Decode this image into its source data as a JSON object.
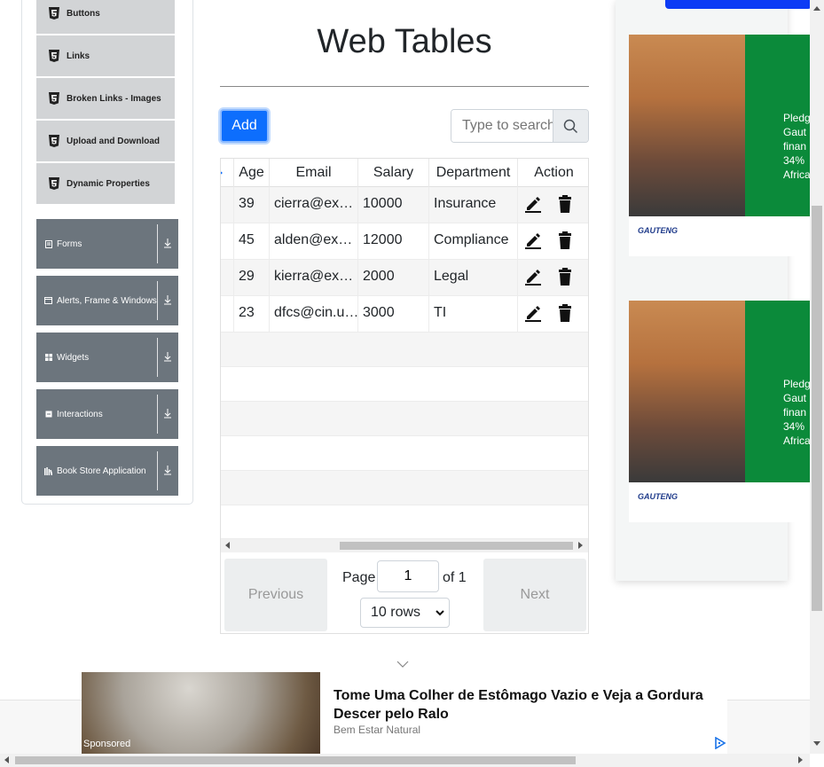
{
  "sidebar": {
    "sub_items": [
      "Buttons",
      "Links",
      "Broken Links - Images",
      "Upload and Download",
      "Dynamic Properties"
    ],
    "groups": [
      "Forms",
      "Alerts, Frame & Windows",
      "Widgets",
      "Interactions",
      "Book Store Application"
    ]
  },
  "main": {
    "title": "Web Tables",
    "add_label": "Add",
    "search": {
      "placeholder": "Type to search"
    }
  },
  "table": {
    "columns": [
      "Age",
      "Email",
      "Salary",
      "Department",
      "Action"
    ],
    "rows": [
      {
        "age": "39",
        "email": "cierra@ex…",
        "salary": "10000",
        "department": "Insurance"
      },
      {
        "age": "45",
        "email": "alden@ex…",
        "salary": "12000",
        "department": "Compliance"
      },
      {
        "age": "29",
        "email": "kierra@ex…",
        "salary": "2000",
        "department": "Legal"
      },
      {
        "age": "23",
        "email": "dfcs@cin.u…",
        "salary": "3000",
        "department": "TI"
      }
    ],
    "empty_rows": 6
  },
  "pagination": {
    "previous_label": "Previous",
    "next_label": "Next",
    "page_label": "Page",
    "page_value": "1",
    "of_label": "of 1",
    "rows_option": "10 rows"
  },
  "right_ads": {
    "text": [
      "Pledg",
      "Gaut",
      "finan",
      "34% ",
      "Africa"
    ],
    "logo": "GAUTENG"
  },
  "bottom_ad": {
    "title": "Tome Uma Colher de Estômago Vazio e Veja a Gordura Descer pelo Ralo",
    "source": "Bem Estar Natural",
    "sponsored": "Sponsored"
  }
}
